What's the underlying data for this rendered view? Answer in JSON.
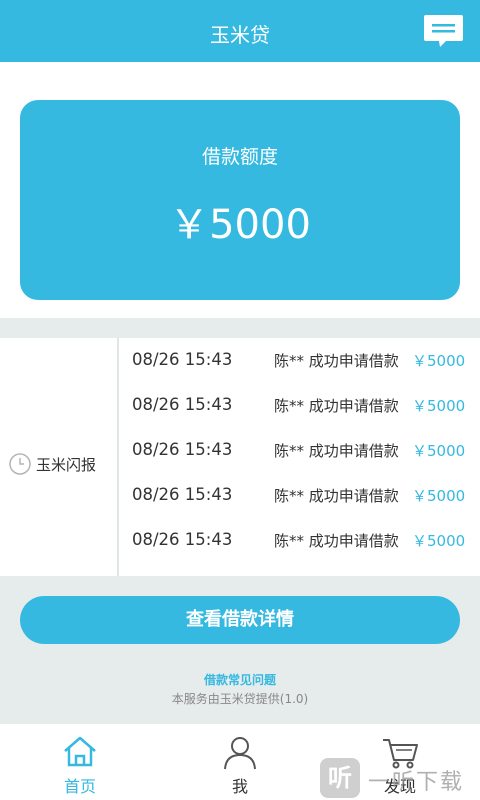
{
  "header": {
    "title": "玉米贷"
  },
  "quota": {
    "label": "借款额度",
    "amount": "￥5000"
  },
  "flash": {
    "label": "玉米闪报",
    "items": [
      {
        "time": "08/26 15:43",
        "msg": "陈** 成功申请借款",
        "amount": "￥5000"
      },
      {
        "time": "08/26 15:43",
        "msg": "陈** 成功申请借款",
        "amount": "￥5000"
      },
      {
        "time": "08/26 15:43",
        "msg": "陈** 成功申请借款",
        "amount": "￥5000"
      },
      {
        "time": "08/26 15:43",
        "msg": "陈** 成功申请借款",
        "amount": "￥5000"
      },
      {
        "time": "08/26 15:43",
        "msg": "陈** 成功申请借款",
        "amount": "￥5000"
      }
    ]
  },
  "actions": {
    "detail_button": "查看借款详情"
  },
  "footer": {
    "faq": "借款常见问题",
    "provider": "本服务由玉米贷提供(1.0)"
  },
  "tabs": [
    {
      "label": "首页",
      "icon": "home-icon",
      "active": true
    },
    {
      "label": "我",
      "icon": "user-icon",
      "active": false
    },
    {
      "label": "发现",
      "icon": "cart-icon",
      "active": false
    }
  ],
  "watermark": {
    "icon_char": "听",
    "text": "一听下载"
  },
  "colors": {
    "accent": "#35b9e0",
    "background": "#e6ebeb",
    "text": "#333333"
  }
}
